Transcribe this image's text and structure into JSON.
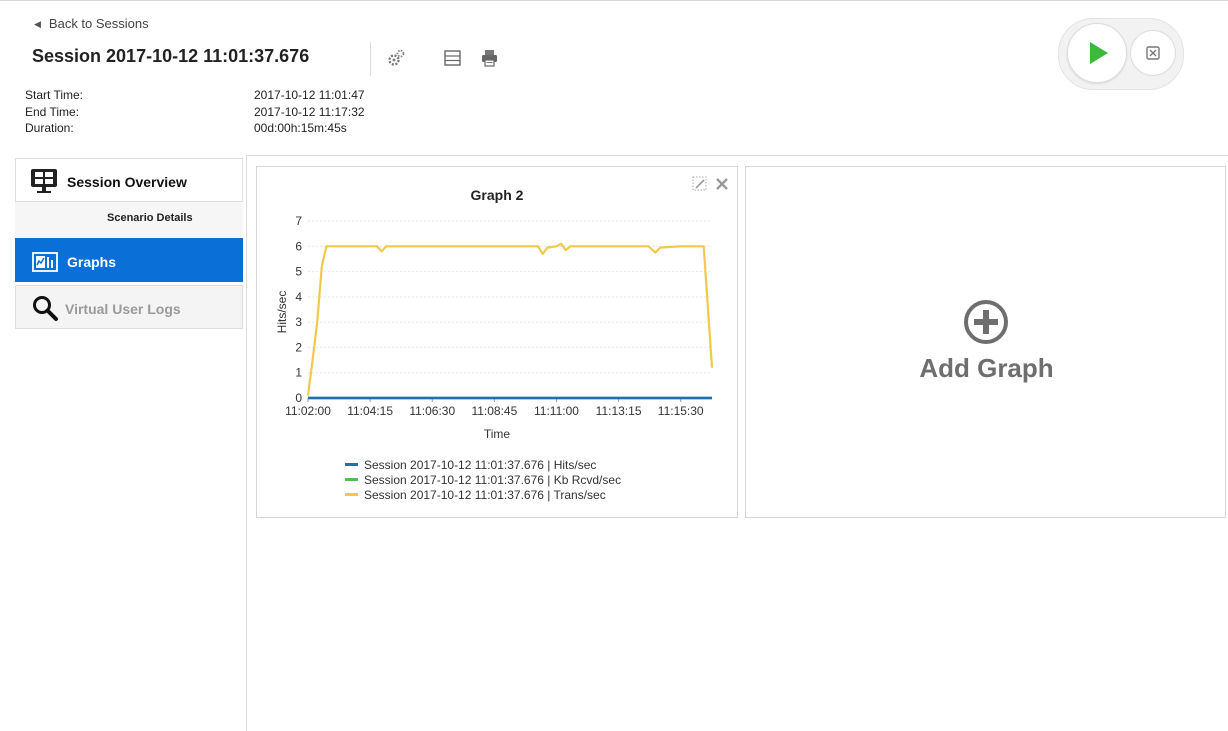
{
  "header": {
    "back_label": "Back to Sessions",
    "session_title": "Session 2017-10-12 11:01:37.676",
    "icons": [
      "settings-gears-icon",
      "layout-icon",
      "print-icon"
    ],
    "meta": [
      {
        "label": "Start Time:",
        "value": "2017-10-12 11:01:47"
      },
      {
        "label": "End Time:",
        "value": "2017-10-12 11:17:32"
      },
      {
        "label": "Duration:",
        "value": "00d:00h:15m:45s"
      }
    ]
  },
  "controls": {
    "play_icon": "play-icon",
    "stop_icon": "stop-icon",
    "play_color": "#3db83d"
  },
  "sidebar": {
    "items": [
      {
        "label": "Session Overview",
        "icon": "monitor-icon",
        "state": "normal"
      },
      {
        "label": "Scenario Details",
        "state": "sub"
      },
      {
        "label": "Graphs",
        "icon": "graphs-icon",
        "state": "active",
        "color": "#0a6fd6"
      },
      {
        "label": "Virtual User Logs",
        "icon": "magnifier-icon",
        "state": "disabled"
      }
    ]
  },
  "graph_panel": {
    "title": "Graph 2",
    "edit_icon": "edit-icon",
    "close_icon": "close-icon"
  },
  "add_panel": {
    "label": "Add Graph",
    "icon": "plus-circle-icon"
  },
  "chart_data": {
    "type": "line",
    "title": "Graph 2",
    "xlabel": "Time",
    "ylabel": "Hits/sec",
    "ylim": [
      0,
      7
    ],
    "xlim": [
      "11:02:00",
      "11:16:38"
    ],
    "y_ticks": [
      0,
      1,
      2,
      3,
      4,
      5,
      6,
      7
    ],
    "x_ticks": [
      "11:02:00",
      "11:04:15",
      "11:06:30",
      "11:08:45",
      "11:11:00",
      "11:13:15",
      "11:15:30"
    ],
    "grid": true,
    "legend_position": "bottom",
    "series": [
      {
        "name": "Session 2017-10-12 11:01:37.676 | Hits/sec",
        "color": "#1f6fb5",
        "x": [
          "11:02:00",
          "11:16:38"
        ],
        "y": [
          0,
          0
        ]
      },
      {
        "name": "Session 2017-10-12 11:01:37.676 | Kb Rcvd/sec",
        "color": "#5cb85c",
        "x": [
          "11:02:00",
          "11:16:38"
        ],
        "y": [
          0,
          0
        ]
      },
      {
        "name": "Session 2017-10-12 11:01:37.676 | Trans/sec",
        "color": "#f0c94a",
        "x": [
          "11:02:00",
          "11:02:10",
          "11:02:20",
          "11:02:30",
          "11:02:40",
          "11:03:00",
          "11:04:30",
          "11:04:40",
          "11:04:50",
          "11:05:30",
          "11:06:30",
          "11:07:30",
          "11:08:30",
          "11:09:30",
          "11:10:20",
          "11:10:30",
          "11:10:40",
          "11:11:00",
          "11:11:10",
          "11:11:20",
          "11:11:30",
          "11:12:30",
          "11:13:30",
          "11:14:20",
          "11:14:35",
          "11:14:45",
          "11:15:30",
          "11:16:20",
          "11:16:38"
        ],
        "y": [
          0.1,
          1.5,
          3,
          5.2,
          6,
          6,
          6,
          5.8,
          6,
          6,
          6,
          6,
          6,
          6,
          6,
          5.7,
          5.95,
          6,
          6.1,
          5.85,
          6,
          6,
          6,
          6,
          5.75,
          5.95,
          6,
          6,
          1.2
        ]
      }
    ]
  }
}
